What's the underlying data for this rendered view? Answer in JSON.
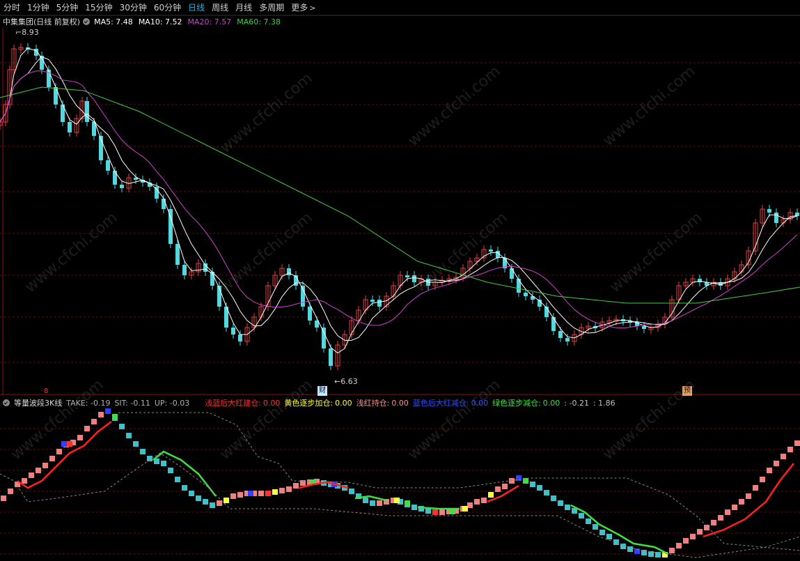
{
  "toolbar": {
    "items": [
      "分时",
      "1分钟",
      "5分钟",
      "15分钟",
      "30分钟",
      "60分钟",
      "日线",
      "周线",
      "月线",
      "多周期",
      "更多"
    ],
    "active": "日线",
    "more_chevron": ">"
  },
  "main_info": {
    "title": "中集集团(日线 前复权)",
    "ma5": "MA5: 7.48",
    "ma10": "MA10: 7.52",
    "ma20": "MA20: 7.57",
    "ma60": "MA60: 7.38"
  },
  "annotations": {
    "high": "8.93",
    "low": "6.63",
    "marker_cai": "财",
    "marker_yu": "预",
    "marker_red": "8"
  },
  "sub_info": {
    "title": "等量波段3K线",
    "take": "TAKE: -0.19",
    "sit": "SIT: -0.11",
    "up": "UP: -0.03",
    "blue_red_label": "浅蓝后大红建仓:",
    "blue_red_value": "0.00",
    "yellow_label": "黄色逐步加仓:",
    "yellow_value": "0.00",
    "light_red_label": "浅红持仓:",
    "light_red_value": "0.00",
    "deep_blue_label": "蓝色后大红减仓:",
    "deep_blue_value": "0.00",
    "green_label": "绿色逐步减仓:",
    "green_value": "0.00",
    "extra1": ": -0.21",
    "extra2": ": 1.86"
  },
  "watermark": "www.cfchi.com",
  "colors": {
    "up_candle": "#e04040",
    "down_candle": "#54d8e0",
    "ma5": "#ffffff",
    "ma10": "#ffffff",
    "ma20": "#d040d0",
    "ma60": "#40d040",
    "active_tab": "#1fb3e8",
    "grid": "#5a1010"
  }
}
